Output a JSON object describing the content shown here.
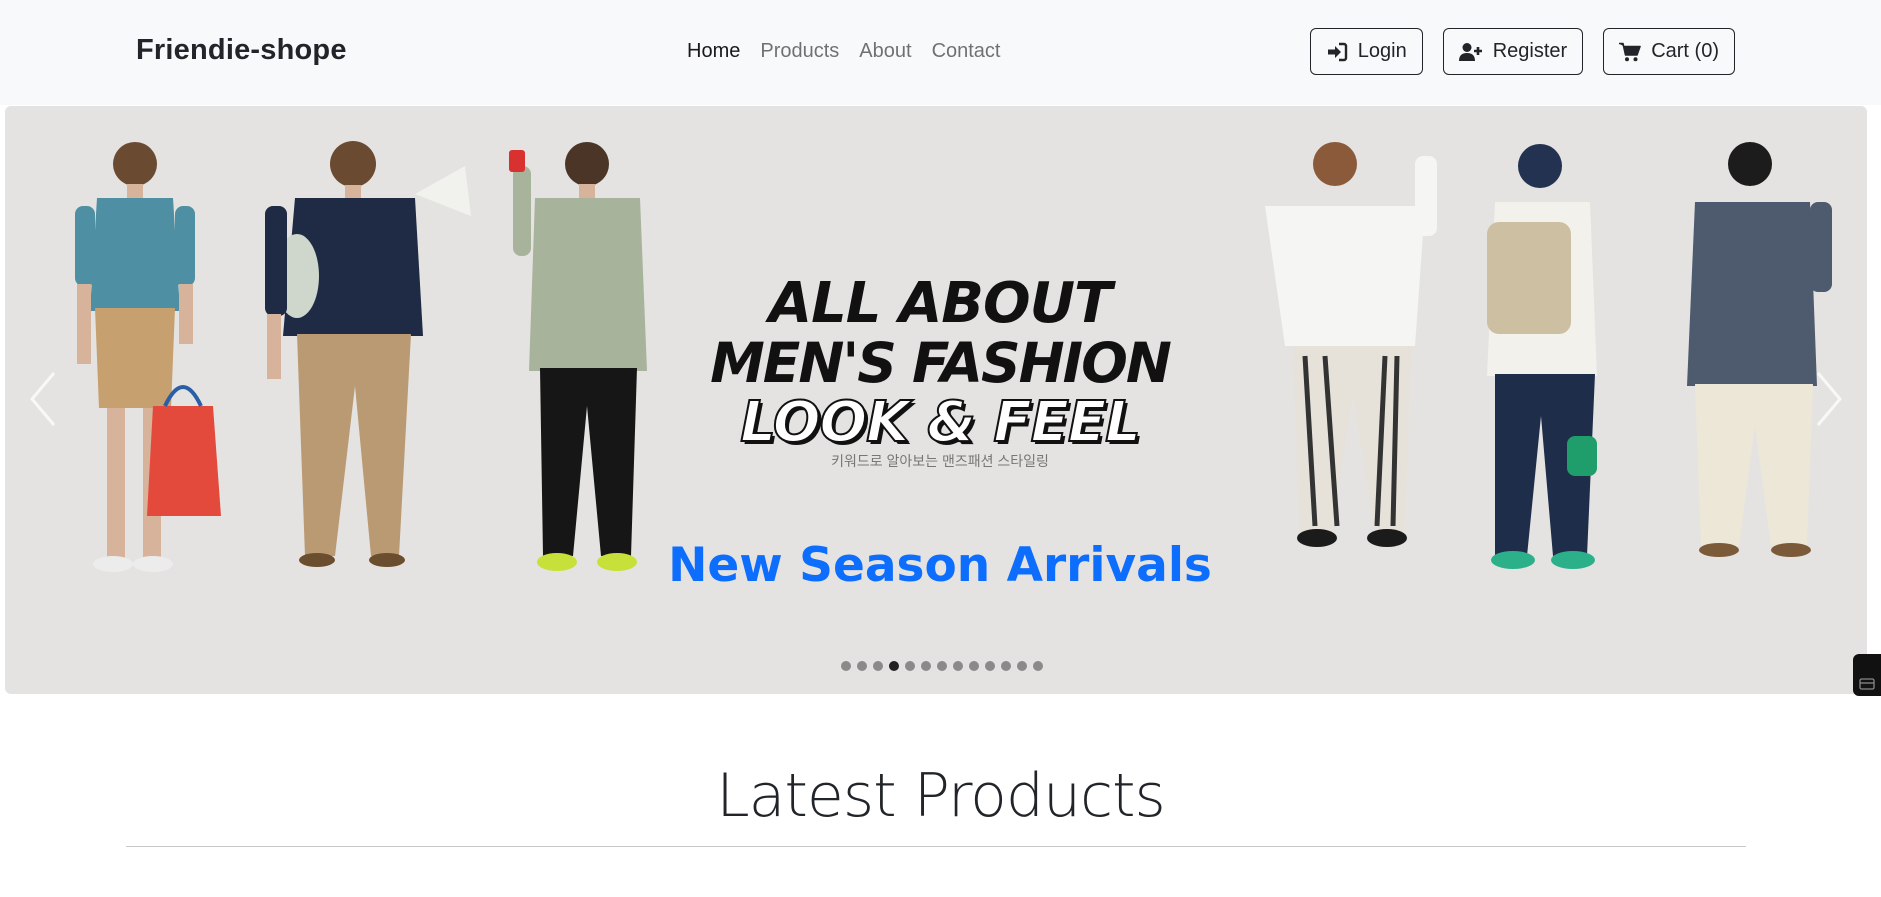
{
  "navbar": {
    "brand": "Friendie-shope",
    "links": [
      {
        "label": "Home",
        "active": true
      },
      {
        "label": "Products",
        "active": false
      },
      {
        "label": "About",
        "active": false
      },
      {
        "label": "Contact",
        "active": false
      }
    ],
    "buttons": {
      "login": {
        "label": "Login",
        "icon": "sign-in-icon"
      },
      "register": {
        "label": "Register",
        "icon": "user-plus-icon"
      },
      "cart": {
        "label": "Cart (0)",
        "icon": "cart-icon"
      }
    }
  },
  "carousel": {
    "headline": [
      "ALL ABOUT",
      "MEN'S FASHION",
      "LOOK & FEEL"
    ],
    "subtext": "키워드로 알아보는 맨즈패션 스타일링",
    "caption": "New Season Arrivals",
    "slide_count": 13,
    "active_slide": 3,
    "caption_color": "#0d6efd",
    "background": "#e4e3e1"
  },
  "section": {
    "title": "Latest Products"
  }
}
